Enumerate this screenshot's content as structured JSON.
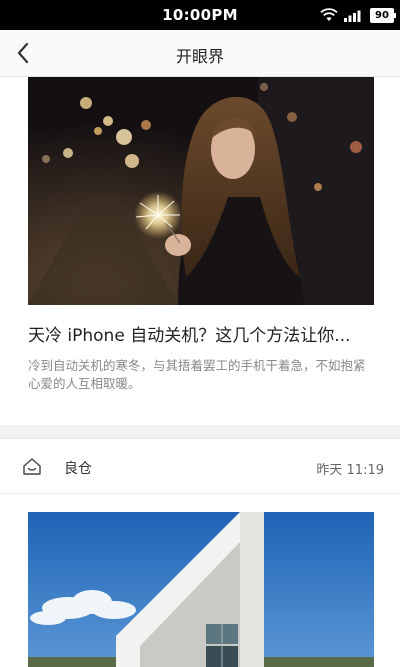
{
  "status_bar": {
    "time": "10:00PM",
    "battery": "90",
    "icons": [
      "wifi-icon",
      "signal-icon",
      "battery-icon"
    ]
  },
  "nav": {
    "title": "开眼界",
    "back_icon": "chevron-left-icon"
  },
  "articles": [
    {
      "title": "天冷 iPhone 自动关机？这几个方法让你...",
      "summary": "冷到自动关机的寒冬，与其捂着罢工的手机干着急，不如抱紧心爱的人互相取暖。",
      "image": "woman-holding-sparkler-photo"
    }
  ],
  "feed_source": {
    "name": "良仓",
    "time": "昨天 11:19",
    "icon": "liangcang-logo-icon",
    "image": "white-building-blue-sky-photo"
  },
  "colors": {
    "background": "#f2f2f2",
    "text_primary": "#222222",
    "text_secondary": "#888888"
  }
}
